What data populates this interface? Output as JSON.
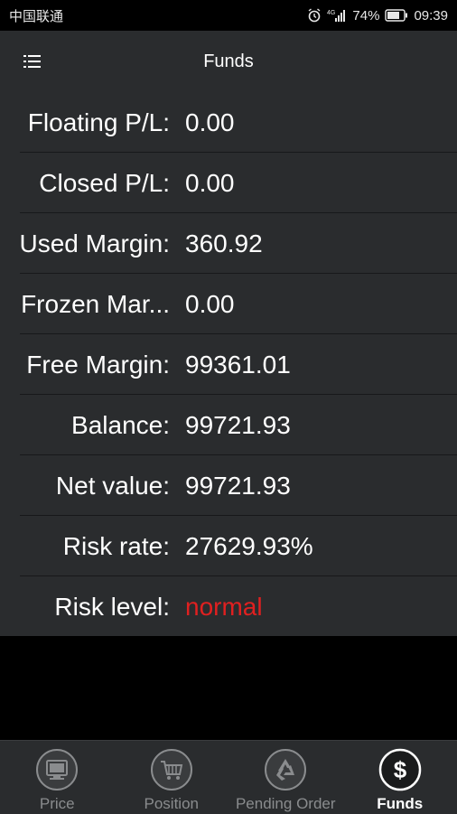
{
  "status_bar": {
    "carrier": "中国联通",
    "battery": "74%",
    "time": "09:39",
    "network": "4G"
  },
  "header": {
    "title": "Funds",
    "menu_icon": "list-menu-icon"
  },
  "funds": {
    "rows": [
      {
        "label": "Floating P/L:",
        "value": "0.00"
      },
      {
        "label": "Closed P/L:",
        "value": "0.00"
      },
      {
        "label": "Used Margin:",
        "value": "360.92"
      },
      {
        "label": "Frozen Mar...",
        "value": "0.00"
      },
      {
        "label": "Free Margin:",
        "value": "99361.01"
      },
      {
        "label": "Balance:",
        "value": "99721.93"
      },
      {
        "label": "Net value:",
        "value": "99721.93"
      },
      {
        "label": "Risk rate:",
        "value": "27629.93%"
      },
      {
        "label": "Risk level:",
        "value": "normal",
        "color": "#e02020"
      }
    ]
  },
  "bottom_nav": {
    "items": [
      {
        "label": "Price",
        "icon": "monitor-icon"
      },
      {
        "label": "Position",
        "icon": "cart-icon"
      },
      {
        "label": "Pending Order",
        "icon": "recycle-icon"
      },
      {
        "label": "Funds",
        "icon": "dollar-icon",
        "active": true
      }
    ]
  },
  "colors": {
    "background": "#2a2c2e",
    "text": "#ffffff",
    "risk_normal": "#e02020",
    "nav_inactive": "#8a8c8e"
  }
}
